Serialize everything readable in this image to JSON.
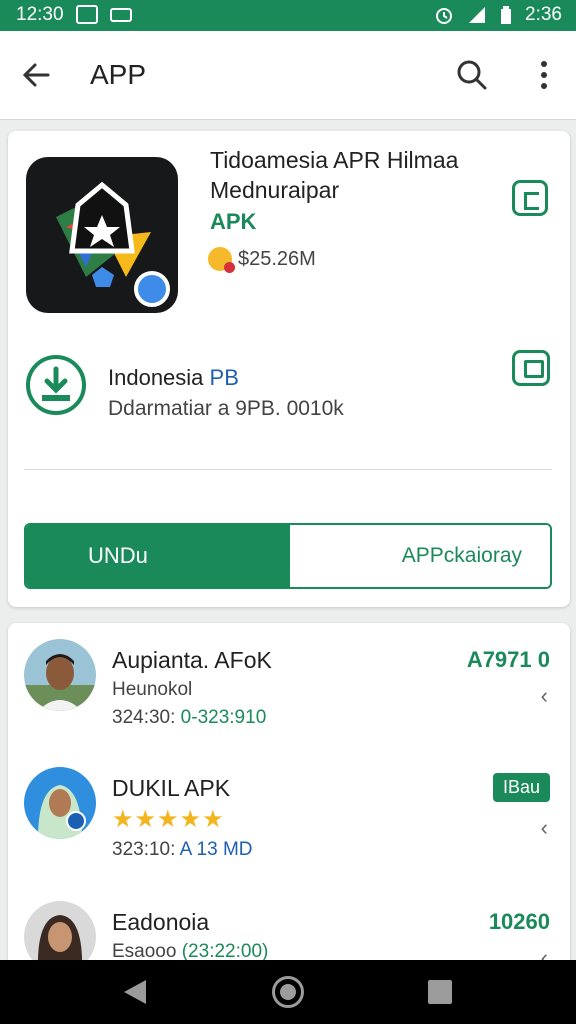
{
  "status_bar": {
    "time_left": "12:30",
    "time_right": "2:36",
    "left_icons": [
      "image-icon",
      "message-icon"
    ],
    "right_icons": [
      "alarm-icon",
      "signal-icon",
      "wifi-icon",
      "battery-icon"
    ]
  },
  "app_bar": {
    "title": "APP",
    "back_icon": "back-arrow-icon",
    "search_icon": "search-icon",
    "menu_icon": "more-vert-icon"
  },
  "app_card": {
    "title": "Tidoamesia APR Hilmaa Mednuraipar",
    "apk_label": "APK",
    "price": "$25.26M",
    "download": {
      "title_main": "Indonesia ",
      "title_accent": "PB",
      "subtitle": "Ddarmatiar a 9PB. 0010k"
    },
    "buttons": {
      "primary": "UNDu",
      "secondary": "APPckaioray"
    }
  },
  "list": [
    {
      "name": "Aupianta. AFoK",
      "sub1": "Heunokol",
      "sub2_prefix": "324:30:",
      "sub2_green": " 0-323:910",
      "value": "A7971 0"
    },
    {
      "name": "DUKIL APK",
      "rating": "★★★★★",
      "sub2_prefix": "323:10: ",
      "sub2_green": "A 13 MD",
      "badge": "IBau"
    },
    {
      "name": "Eadonoia",
      "sub1": "Esaooo ",
      "sub1_green": "(23:22:00)",
      "value": "10260"
    }
  ],
  "colors": {
    "accent": "#1b8a5a",
    "background": "#eceeed",
    "star": "#f3b51e"
  }
}
